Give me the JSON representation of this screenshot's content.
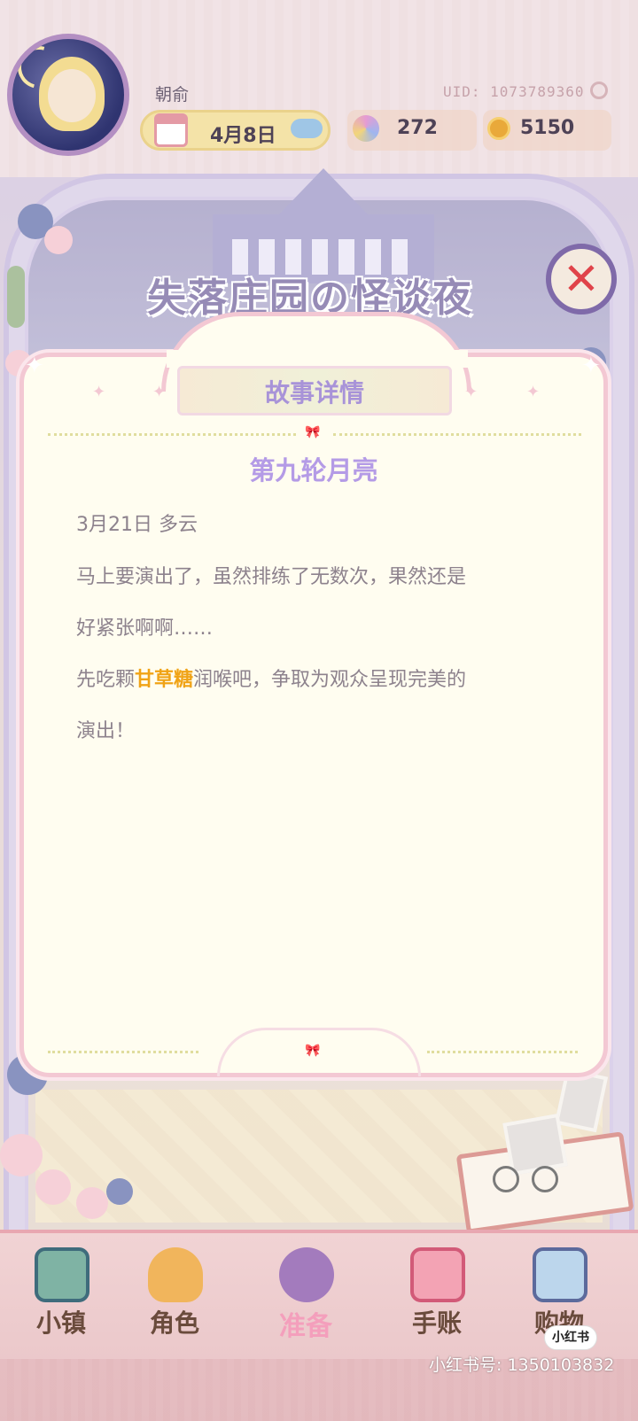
{
  "header": {
    "username": "朝俞",
    "uid": "UID: 1073789360",
    "date": "4月8日",
    "gems": "272",
    "coins": "5150"
  },
  "banner": {
    "title": "失落庄园の怪谈夜"
  },
  "dialog": {
    "header": "故事详情",
    "story_title": "第九轮月亮",
    "date_weather": "3月21日  多云",
    "line1": "马上要演出了，虽然排练了无数次，果然还是",
    "line2": "好紧张啊啊……",
    "line3_before": "先吃颗",
    "line3_highlight": "甘草糖",
    "line3_after": "润喉吧，争取为观众呈现完美的",
    "line4": "演出！"
  },
  "nav": [
    {
      "label": "小镇",
      "icon": "map-icon"
    },
    {
      "label": "角色",
      "icon": "character-icon"
    },
    {
      "label": "准备",
      "icon": "prepare-icon"
    },
    {
      "label": "手账",
      "icon": "journal-icon"
    },
    {
      "label": "购物",
      "icon": "shopping-bag-icon"
    }
  ],
  "watermark": {
    "badge": "小红书",
    "text": "小红书号: 1350103832"
  },
  "colors": {
    "accent_purple": "#a893d8",
    "highlight_orange": "#f0a316",
    "nav_text": "#6a4b3c",
    "nav_active": "#f49fbc"
  }
}
